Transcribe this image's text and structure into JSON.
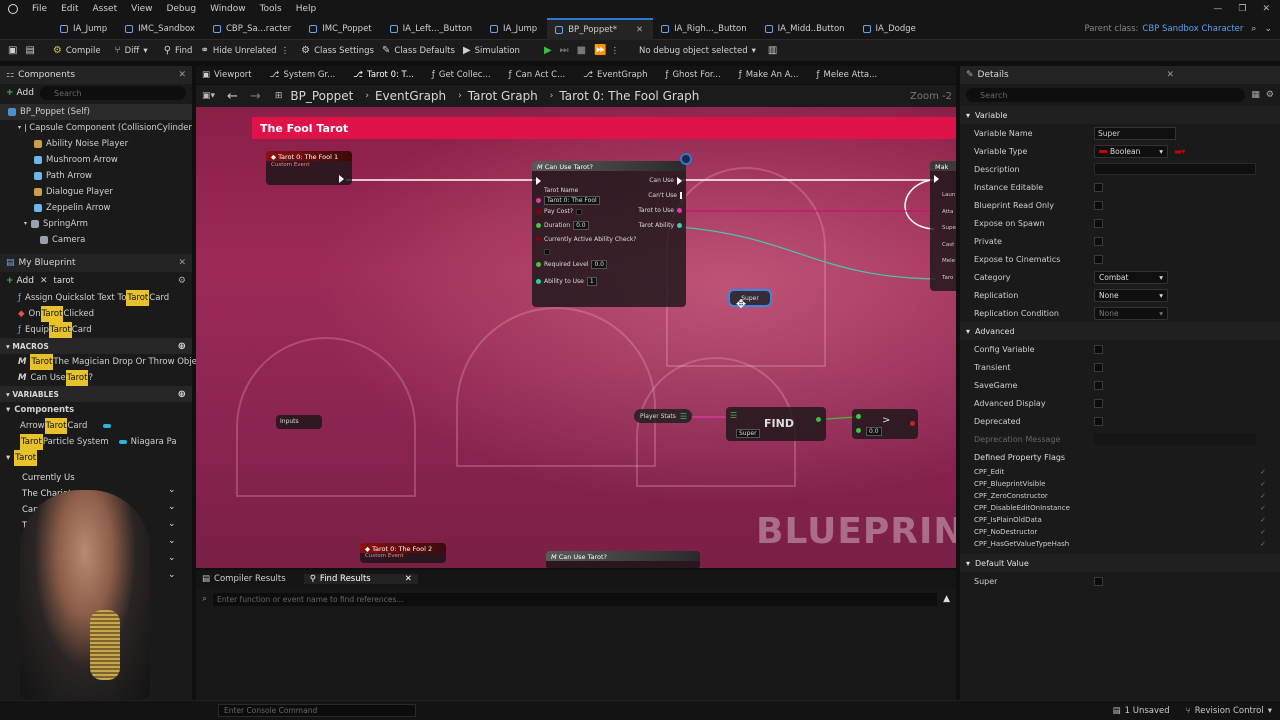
{
  "menu": [
    "File",
    "Edit",
    "Asset",
    "View",
    "Debug",
    "Window",
    "Tools",
    "Help"
  ],
  "doc_tabs": [
    {
      "label": "IA_Jump",
      "active": false
    },
    {
      "label": "IMC_Sandbox",
      "active": false
    },
    {
      "label": "CBP_Sa...racter",
      "active": false
    },
    {
      "label": "IMC_Poppet",
      "active": false
    },
    {
      "label": "IA_Left..._Button",
      "active": false
    },
    {
      "label": "IA_Jump",
      "active": false
    },
    {
      "label": "BP_Poppet*",
      "active": true
    },
    {
      "label": "IA_Righ..._Button",
      "active": false
    },
    {
      "label": "IA_Midd..Button",
      "active": false
    },
    {
      "label": "IA_Dodge",
      "active": false
    }
  ],
  "parent_class": {
    "label": "Parent class:",
    "value": "CBP Sandbox Character"
  },
  "toolbar": {
    "compile": "Compile",
    "diff": "Diff",
    "find": "Find",
    "hide_unrelated": "Hide Unrelated",
    "class_settings": "Class Settings",
    "class_defaults": "Class Defaults",
    "simulation": "Simulation",
    "debug_object": "No debug object selected"
  },
  "components": {
    "title": "Components",
    "add": "Add",
    "search_placeholder": "Search",
    "items": [
      {
        "label": "BP_Poppet (Self)",
        "indent": 0
      },
      {
        "label": "Capsule Component (CollisionCylinder",
        "indent": 1
      },
      {
        "label": "Ability Noise Player",
        "indent": 2
      },
      {
        "label": "Mushroom Arrow",
        "indent": 2
      },
      {
        "label": "Path Arrow",
        "indent": 2
      },
      {
        "label": "Dialogue Player",
        "indent": 2
      },
      {
        "label": "Zeppelin Arrow",
        "indent": 2
      },
      {
        "label": "SpringArm",
        "indent": 2
      },
      {
        "label": "Camera",
        "indent": 3
      }
    ]
  },
  "my_blueprint": {
    "title": "My Blueprint",
    "add": "Add",
    "search_value": "tarot",
    "functions": [
      {
        "pre": "Assign Quickslot Text To ",
        "hl": "Tarot",
        "post": " Card"
      },
      {
        "pre": "On ",
        "hl": "Tarot",
        "post": " Clicked"
      },
      {
        "pre": "Equip ",
        "hl": "Tarot",
        "post": " Card"
      }
    ],
    "macros_label": "MACROS",
    "macros": [
      {
        "pre": "",
        "hl": "Tarot",
        "post": " The Magician Drop Or Throw Objec"
      },
      {
        "pre": "Can Use ",
        "hl": "Tarot",
        "post": "?"
      }
    ],
    "variables_label": "VARIABLES",
    "components_label": "Components",
    "variables": [
      {
        "pre": "Arrow ",
        "hl": "Tarot",
        "post": " Card",
        "type": ""
      },
      {
        "pre": "",
        "hl": "Tarot",
        "post": " Particle System",
        "type": "Niagara Pa"
      }
    ],
    "tarot_group": "Tarot",
    "tarot_items": [
      "Currently Us",
      "The Chariot",
      "Captured C",
      "Th"
    ]
  },
  "graph_tabs": [
    "Viewport",
    "System Gr...",
    "Tarot 0: T...",
    "Get Collec...",
    "Can Act C...",
    "EventGraph",
    "Ghost For...",
    "Make An A...",
    "Melee Atta..."
  ],
  "breadcrumb": [
    "BP_Poppet",
    "EventGraph",
    "Tarot Graph",
    "Tarot 0: The Fool Graph"
  ],
  "zoom": "Zoom -2",
  "graph": {
    "comment_title": "The Fool Tarot",
    "event_node": {
      "title": "Tarot 0: The Fool 1",
      "subtitle": "Custom Event"
    },
    "event_node2": {
      "title": "Tarot 0: The Fool 2",
      "subtitle": "Custom Event"
    },
    "macro_node": {
      "title": "Can Use Tarot?",
      "inputs": [
        {
          "label": "Tarot Name",
          "value": "Tarot 0: The Fool"
        },
        {
          "label": "Pay Cost?",
          "value": ""
        },
        {
          "label": "Duration",
          "value": "0.0"
        },
        {
          "label": "Currently Active Ability Check?",
          "value": ""
        },
        {
          "label": "Required Level",
          "value": "0.0"
        },
        {
          "label": "Ability to Use",
          "value": "1"
        }
      ],
      "outputs": [
        "Can Use",
        "Can't Use",
        "Tarot to Use",
        "Tarot Ability"
      ]
    },
    "macro_node2_title": "Can Use Tarot?",
    "super_var": "Super",
    "inputs_node": "Inputs",
    "player_stats": "Player Stats",
    "find_label": "FIND",
    "find_key": "Super",
    "compare_value": "0.0",
    "right_pins": [
      "Laun",
      "Atta",
      "Supe",
      "Cast",
      "Mele",
      "Taro"
    ],
    "watermark": "BLUEPRINT"
  },
  "bottom": {
    "tabs": [
      "Compiler Results",
      "Find Results"
    ],
    "search_placeholder": "Enter function or event name to find references..."
  },
  "details": {
    "title": "Details",
    "search_placeholder": "Search",
    "variable_section": "Variable",
    "rows": [
      {
        "label": "Variable Name",
        "kind": "text",
        "value": "Super"
      },
      {
        "label": "Variable Type",
        "kind": "dropdown",
        "value": "Boolean"
      },
      {
        "label": "Description",
        "kind": "text",
        "value": ""
      },
      {
        "label": "Instance Editable",
        "kind": "check",
        "value": ""
      },
      {
        "label": "Blueprint Read Only",
        "kind": "check",
        "value": ""
      },
      {
        "label": "Expose on Spawn",
        "kind": "check",
        "value": ""
      },
      {
        "label": "Private",
        "kind": "check",
        "value": ""
      },
      {
        "label": "Expose to Cinematics",
        "kind": "check",
        "value": ""
      },
      {
        "label": "Category",
        "kind": "dropdown",
        "value": "Combat"
      },
      {
        "label": "Replication",
        "kind": "dropdown",
        "value": "None"
      },
      {
        "label": "Replication Condition",
        "kind": "dropdown",
        "value": "None"
      }
    ],
    "advanced_section": "Advanced",
    "adv_rows": [
      "Config Variable",
      "Transient",
      "SaveGame",
      "Advanced Display",
      "Deprecated"
    ],
    "deprecation_msg": "Deprecation Message",
    "flags_label": "Defined Property Flags",
    "flags": [
      "CPF_Edit",
      "CPF_BlueprintVisible",
      "CPF_ZeroConstructor",
      "CPF_DisableEditOnInstance",
      "CPF_IsPlainOldData",
      "CPF_NoDestructor",
      "CPF_HasGetValueTypeHash"
    ],
    "default_section": "Default Value",
    "default_label": "Super"
  },
  "status": {
    "console_placeholder": "Enter Console Command",
    "unsaved": "1 Unsaved",
    "revision": "Revision Control"
  },
  "colors": {
    "accent": "#2a7ad5",
    "comment": "#e0124a",
    "exec_green": "#3cbf3c",
    "highlight": "#e8c22a",
    "boolean": "#8c0000"
  }
}
